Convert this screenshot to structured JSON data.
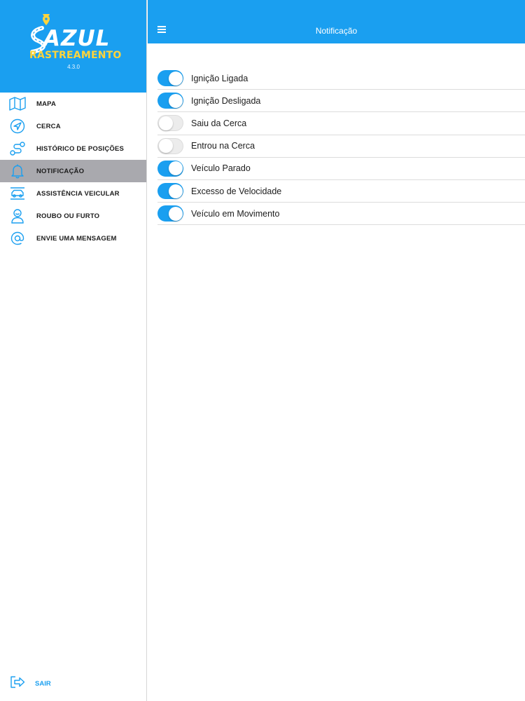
{
  "brand": {
    "name": "AZUL",
    "subtitle": "RASTREAMENTO",
    "version": "4.3.0",
    "color": "#1a9ff0",
    "accent": "#ffd43b"
  },
  "sidebar": {
    "items": [
      {
        "label": "MAPA",
        "icon": "map-icon",
        "active": false
      },
      {
        "label": "CERCA",
        "icon": "navigation-arrow-icon",
        "active": false
      },
      {
        "label": "HISTÓRICO DE POSIÇÕES",
        "icon": "route-icon",
        "active": false
      },
      {
        "label": "NOTIFICAÇÃO",
        "icon": "bell-icon",
        "active": true
      },
      {
        "label": "ASSISTÊNCIA VEICULAR",
        "icon": "car-assistance-icon",
        "active": false
      },
      {
        "label": "ROUBO OU FURTO",
        "icon": "person-alert-icon",
        "active": false
      },
      {
        "label": "ENVIE UMA MENSAGEM",
        "icon": "at-sign-icon",
        "active": false
      }
    ],
    "logout_label": "SAIR"
  },
  "header": {
    "title": "Notificação"
  },
  "notifications": [
    {
      "label": "Ignição Ligada",
      "enabled": true
    },
    {
      "label": "Ignição Desligada",
      "enabled": true
    },
    {
      "label": "Saiu da Cerca",
      "enabled": false
    },
    {
      "label": "Entrou na Cerca",
      "enabled": false
    },
    {
      "label": "Veículo Parado",
      "enabled": true
    },
    {
      "label": "Excesso de Velocidade",
      "enabled": true
    },
    {
      "label": "Veículo em Movimento",
      "enabled": true
    }
  ]
}
